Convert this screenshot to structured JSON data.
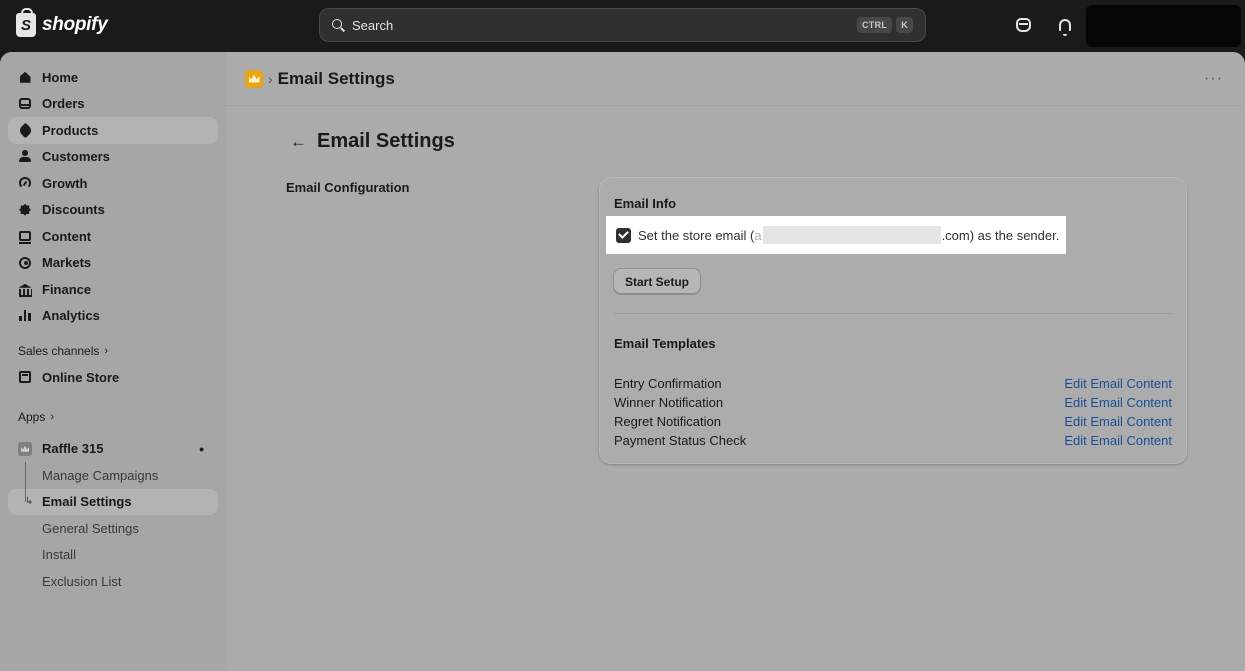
{
  "topbar": {
    "brand": "shopify",
    "search_placeholder": "Search",
    "shortcut": [
      "CTRL",
      "K"
    ]
  },
  "sidebar": {
    "items": [
      {
        "label": "Home",
        "icon": "home-icon"
      },
      {
        "label": "Orders",
        "icon": "orders-icon"
      },
      {
        "label": "Products",
        "icon": "tag-icon",
        "active": true
      },
      {
        "label": "Customers",
        "icon": "person-icon"
      },
      {
        "label": "Growth",
        "icon": "gauge-icon"
      },
      {
        "label": "Discounts",
        "icon": "discount-badge-icon"
      },
      {
        "label": "Content",
        "icon": "content-icon"
      },
      {
        "label": "Markets",
        "icon": "globe-icon"
      },
      {
        "label": "Finance",
        "icon": "bank-icon"
      },
      {
        "label": "Analytics",
        "icon": "bar-chart-icon"
      }
    ],
    "sales_channels_label": "Sales channels",
    "online_store_label": "Online Store",
    "apps_label": "Apps",
    "app_name": "Raffle 315",
    "app_subitems": [
      "Manage Campaigns",
      "Email Settings",
      "General Settings",
      "Install",
      "Exclusion List"
    ],
    "active_subitem": "Email Settings"
  },
  "header": {
    "sep": "›",
    "title": "Email Settings",
    "more": "···"
  },
  "page": {
    "back": "←",
    "title": "Email Settings",
    "section_label": "Email Configuration"
  },
  "card": {
    "email_info_title": "Email Info",
    "checkbox_checked": true,
    "checkbox_text_before": "Set the store email (",
    "checkbox_text_visible_char": "a",
    "checkbox_text_after": ".com) as the sender.",
    "start_setup_label": "Start Setup",
    "templates_title": "Email Templates",
    "templates": [
      {
        "name": "Entry Confirmation",
        "action": "Edit Email Content"
      },
      {
        "name": "Winner Notification",
        "action": "Edit Email Content"
      },
      {
        "name": "Regret Notification",
        "action": "Edit Email Content"
      },
      {
        "name": "Payment Status Check",
        "action": "Edit Email Content"
      }
    ]
  },
  "colors": {
    "topbar_bg": "#1a1a1a",
    "overlay_bg": "#ababab",
    "link": "#1c4f96",
    "app_logo": "#e8a517"
  }
}
